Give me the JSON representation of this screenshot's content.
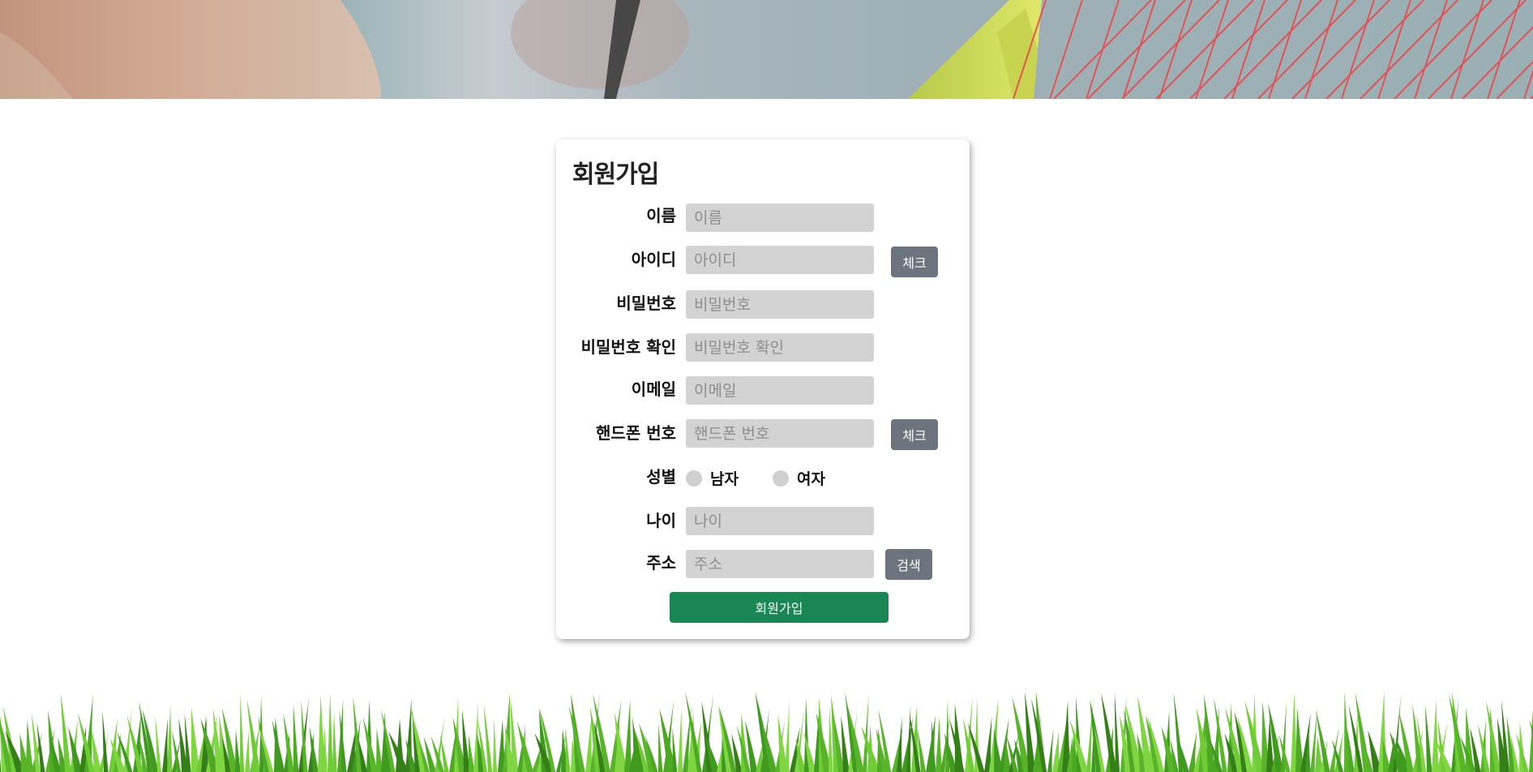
{
  "form": {
    "title": "회원가입",
    "fields": {
      "name": {
        "label": "이름",
        "placeholder": "이름",
        "value": ""
      },
      "userid": {
        "label": "아이디",
        "placeholder": "아이디",
        "value": "",
        "button": "체크"
      },
      "password": {
        "label": "비밀번호",
        "placeholder": "비밀번호",
        "value": ""
      },
      "password_confirm": {
        "label": "비밀번호 확인",
        "placeholder": "비밀번호 확인",
        "value": ""
      },
      "email": {
        "label": "이메일",
        "placeholder": "이메일",
        "value": ""
      },
      "phone": {
        "label": "핸드폰 번호",
        "placeholder": "핸드폰 번호",
        "value": "",
        "button": "체크"
      },
      "gender": {
        "label": "성별",
        "options": [
          "남자",
          "여자"
        ],
        "selected": null
      },
      "age": {
        "label": "나이",
        "placeholder": "나이",
        "value": ""
      },
      "address": {
        "label": "주소",
        "placeholder": "주소",
        "value": "",
        "button": "검색"
      }
    },
    "submit_label": "회원가입"
  },
  "colors": {
    "submit": "#198754",
    "side_button": "#6c757d",
    "input_bg": "#d3d3d3"
  },
  "images": {
    "hero": "tennis-racket-photo",
    "footer": "grass-illustration"
  }
}
